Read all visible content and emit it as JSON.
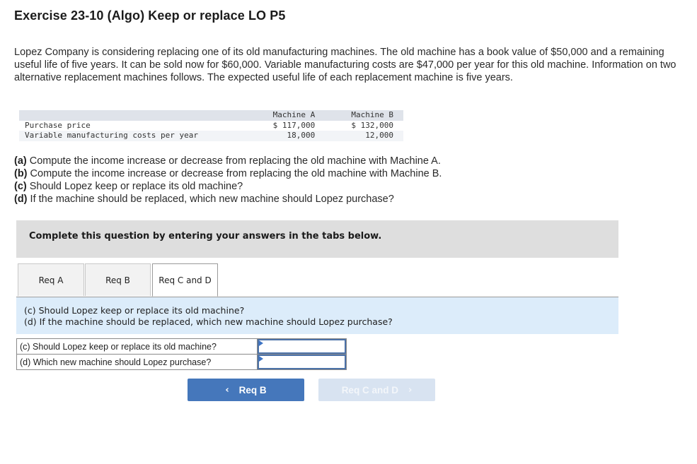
{
  "header": {
    "title": "Exercise 23-10 (Algo) Keep or replace LO P5"
  },
  "intro": {
    "text": "Lopez Company is considering replacing one of its old manufacturing machines. The old machine has a book value of $50,000 and a remaining useful life of five years. It can be sold now for $60,000. Variable manufacturing costs are $47,000 per year for this old machine. Information on two alternative replacement machines follows. The expected useful life of each replacement machine is five years."
  },
  "machine_table": {
    "columns": [
      "",
      "Machine A",
      "Machine B"
    ],
    "rows": [
      {
        "label": "Purchase price",
        "machine_a": "$ 117,000",
        "machine_b": "$ 132,000"
      },
      {
        "label": "Variable manufacturing costs per year",
        "machine_a": "18,000",
        "machine_b": "12,000"
      }
    ]
  },
  "questions": [
    {
      "tag": "(a)",
      "text": " Compute the income increase or decrease from replacing the old machine with Machine A."
    },
    {
      "tag": "(b)",
      "text": " Compute the income increase or decrease from replacing the old machine with Machine B."
    },
    {
      "tag": "(c)",
      "text": " Should Lopez keep or replace its old machine?"
    },
    {
      "tag": "(d)",
      "text": " If the machine should be replaced, which new machine should Lopez purchase?"
    }
  ],
  "instruction": "Complete this question by entering your answers in the tabs below.",
  "tabs": [
    {
      "label": "Req A",
      "active": false
    },
    {
      "label": "Req B",
      "active": false
    },
    {
      "label": "Req C and D",
      "active": true
    }
  ],
  "active_tab_prompt": {
    "line1": "(c) Should Lopez keep or replace its old machine?",
    "line2": "(d) If the machine should be replaced, which new machine should Lopez purchase?"
  },
  "answer_table": {
    "rows": [
      {
        "question": "(c) Should Lopez keep or replace its old machine?",
        "value": ""
      },
      {
        "question": "(d) Which new machine should Lopez purchase?",
        "value": ""
      }
    ]
  },
  "navigation": {
    "prev_label": "Req B",
    "prev_icon": "chevron-left-icon",
    "next_label": "Req C and D",
    "next_icon": "chevron-right-icon",
    "next_disabled": true
  },
  "colors": {
    "primary_button": "#4577bb",
    "disabled_button": "#d8e3f1",
    "prompt_panel": "#dcecfa",
    "instruction_bar": "#dedede",
    "input_border": "#4c72a8"
  }
}
